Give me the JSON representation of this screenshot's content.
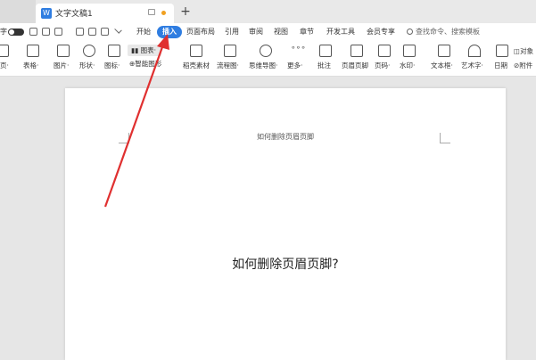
{
  "titlebar": {
    "doc_tab_title": "文字文稿1",
    "new_tab": "+"
  },
  "menubar": {
    "left_fragment": "字",
    "tabs": [
      "开始",
      "插入",
      "页面布局",
      "引用",
      "审阅",
      "视图",
      "章节",
      "开发工具",
      "会员专享"
    ],
    "active_tab": "插入",
    "search_placeholder": "查找命令、搜索模板"
  },
  "ribbon": {
    "items": [
      {
        "label": "页·",
        "icon": "page-icon"
      },
      {
        "label": "表格·",
        "icon": "table-icon"
      },
      {
        "label": "图片·",
        "icon": "picture-icon"
      },
      {
        "label": "形状·",
        "icon": "shape-icon"
      },
      {
        "label": "图标·",
        "icon": "icon-library-icon"
      },
      {
        "label": "稻壳素材",
        "icon": "docer-material-icon"
      },
      {
        "label": "流程图·",
        "icon": "flowchart-icon"
      },
      {
        "label": "思维导图·",
        "icon": "mindmap-icon"
      },
      {
        "label": "更多·",
        "icon": "more-icon"
      },
      {
        "label": "批注",
        "icon": "comment-icon"
      },
      {
        "label": "页眉页脚",
        "icon": "header-footer-icon"
      },
      {
        "label": "页码·",
        "icon": "page-number-icon"
      },
      {
        "label": "水印·",
        "icon": "watermark-icon"
      },
      {
        "label": "文本框·",
        "icon": "textbox-icon"
      },
      {
        "label": "艺术字·",
        "icon": "wordart-icon"
      },
      {
        "label": "日期",
        "icon": "date-icon"
      }
    ],
    "chart_label": "图表·",
    "smart_label": "智能图形",
    "object_label": "对象",
    "attachment_label": "附件"
  },
  "document": {
    "header_text": "如何删除页眉页脚",
    "body_text": "如何删除页眉页脚?"
  },
  "colors": {
    "accent": "#2f7de1",
    "annotation_arrow": "#e03030"
  }
}
